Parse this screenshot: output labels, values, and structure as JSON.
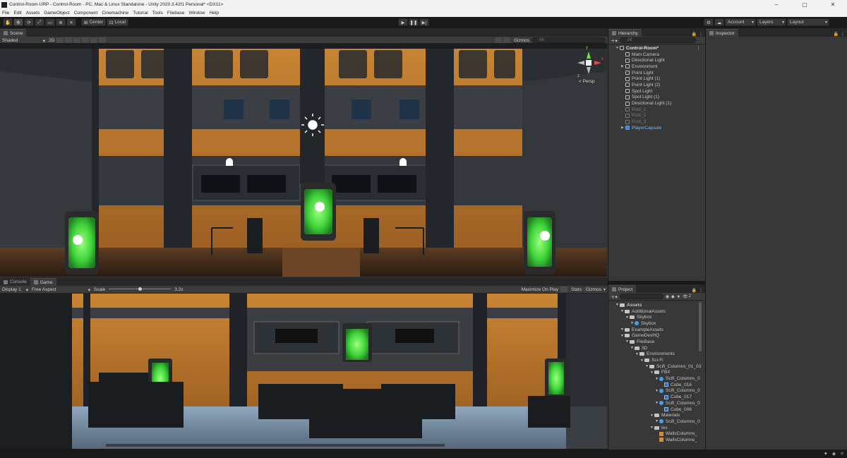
{
  "window": {
    "title": "Control-Room-URP - Control-Room - PC, Mac & Linux Standalone - Unity 2020.3.42f1 Personal* <DX11>",
    "controls": [
      "–",
      "▢",
      "✕"
    ]
  },
  "menu": [
    "File",
    "Edit",
    "Assets",
    "GameObject",
    "Component",
    "Cinemachine",
    "Tutorial",
    "Tools",
    "Filebase",
    "Window",
    "Help"
  ],
  "toolbar": {
    "pivot": "Center",
    "space": "Local",
    "account": "Account",
    "layers": "Layers",
    "layout": "Layout"
  },
  "scene": {
    "tab": "Scene",
    "shading": "Shaded",
    "mode_2d": "2D",
    "gizmos": "Gizmos",
    "search_placeholder": "All",
    "gizmo_label": "< Persp",
    "axis_y": "y",
    "axis_x": "x",
    "axis_z": "z"
  },
  "bottom_tabs": {
    "console": "Console",
    "game": "Game"
  },
  "game": {
    "display": "Display 1",
    "aspect": "Free Aspect",
    "scale_label": "Scale",
    "scale_value": "3.2x",
    "scale_level": 0.5,
    "maximize": "Maximize On Play",
    "stats": "Stats",
    "gizmos": "Gizmos"
  },
  "hierarchy": {
    "tab": "Hierarchy",
    "search_placeholder": "All",
    "root": "Control-Room*",
    "items": [
      {
        "label": "Main Camera",
        "state": "normal",
        "expand": false
      },
      {
        "label": "Directional Light",
        "state": "normal",
        "expand": false
      },
      {
        "label": "Environment",
        "state": "normal",
        "expand": true
      },
      {
        "label": "Point Light",
        "state": "normal",
        "expand": false
      },
      {
        "label": "Point Light (1)",
        "state": "normal",
        "expand": false
      },
      {
        "label": "Point Light (2)",
        "state": "normal",
        "expand": false
      },
      {
        "label": "Spot Light",
        "state": "normal",
        "expand": false
      },
      {
        "label": "Spot Light (1)",
        "state": "normal",
        "expand": false
      },
      {
        "label": "Directional Light (1)",
        "state": "normal",
        "expand": false
      },
      {
        "label": "Post_1",
        "state": "dim",
        "expand": false
      },
      {
        "label": "Post_2",
        "state": "dim",
        "expand": false
      },
      {
        "label": "Post_3",
        "state": "dim",
        "expand": false
      },
      {
        "label": "PlayerCapsule",
        "state": "blue",
        "expand": true
      }
    ]
  },
  "inspector": {
    "tab": "Inspector"
  },
  "project": {
    "tab": "Project",
    "badge": "2",
    "items": [
      {
        "label": "Assets",
        "indent": 0,
        "kind": "folder",
        "bold": true
      },
      {
        "label": "AdditionalAssets",
        "indent": 1,
        "kind": "folder"
      },
      {
        "label": "Skybox",
        "indent": 2,
        "kind": "folder"
      },
      {
        "label": "Skybox",
        "indent": 3,
        "kind": "asset"
      },
      {
        "label": "ExampleAssets",
        "indent": 1,
        "kind": "folder"
      },
      {
        "label": "GameDevHQ",
        "indent": 1,
        "kind": "folder"
      },
      {
        "label": "FileBase",
        "indent": 2,
        "kind": "folder"
      },
      {
        "label": "3D",
        "indent": 3,
        "kind": "folder"
      },
      {
        "label": "Environments",
        "indent": 4,
        "kind": "folder"
      },
      {
        "label": "Sci-Fi",
        "indent": 5,
        "kind": "folder"
      },
      {
        "label": "Scifi_Columns_01_03",
        "indent": 6,
        "kind": "folder"
      },
      {
        "label": "FBX",
        "indent": 7,
        "kind": "folder"
      },
      {
        "label": "Scifi_Columns_0",
        "indent": 8,
        "kind": "asset"
      },
      {
        "label": "Cube_016",
        "indent": 9,
        "kind": "mesh"
      },
      {
        "label": "Scifi_Columns_0",
        "indent": 8,
        "kind": "asset"
      },
      {
        "label": "Cube_017",
        "indent": 9,
        "kind": "mesh"
      },
      {
        "label": "Scifi_Columns_0",
        "indent": 8,
        "kind": "asset"
      },
      {
        "label": "Cube_006",
        "indent": 9,
        "kind": "mesh"
      },
      {
        "label": "Materials",
        "indent": 7,
        "kind": "folder"
      },
      {
        "label": "Scifi_Columns_0",
        "indent": 8,
        "kind": "asset"
      },
      {
        "label": "tex",
        "indent": 7,
        "kind": "folder"
      },
      {
        "label": "WallsColumns_",
        "indent": 8,
        "kind": "texture"
      },
      {
        "label": "WallsColumns_",
        "indent": 8,
        "kind": "texture"
      }
    ]
  },
  "colors": {
    "editor_bg": "#383838",
    "orange_panel": "#b8742a",
    "green_light": "#3fd43a",
    "selection_blue": "#3f84d6"
  }
}
